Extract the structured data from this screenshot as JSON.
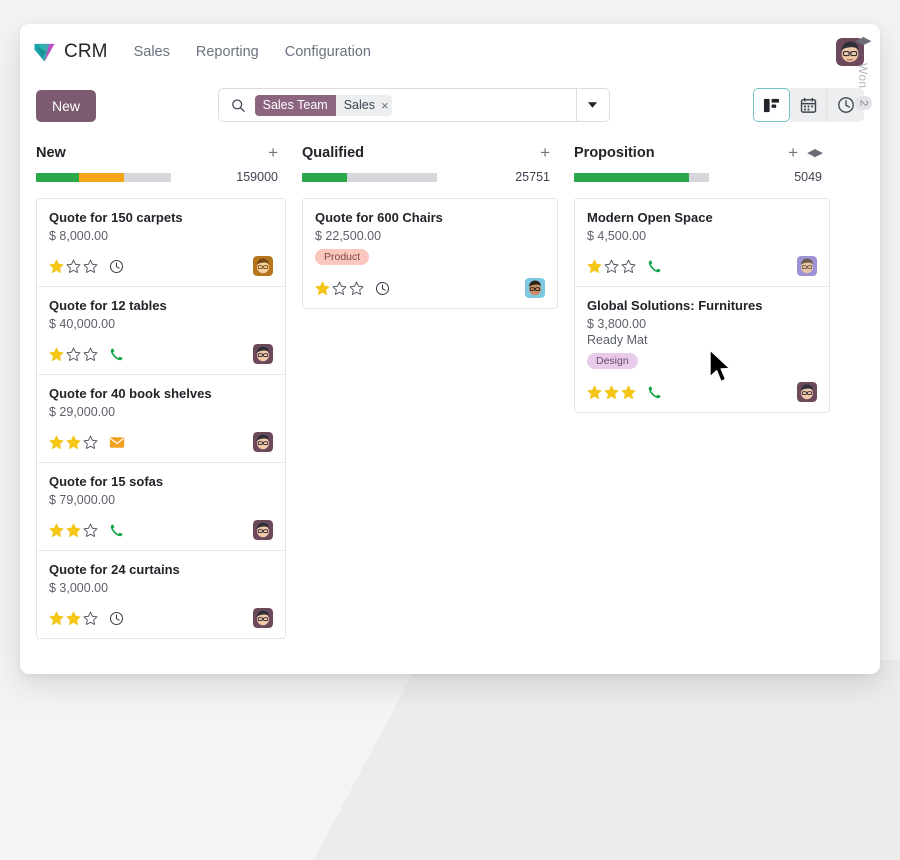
{
  "app": {
    "brand_name": "CRM",
    "logo_icon": "crm-gem-logo"
  },
  "navbar": {
    "items": [
      {
        "label": "Sales"
      },
      {
        "label": "Reporting"
      },
      {
        "label": "Configuration"
      }
    ],
    "user_avatar_icon": "user-avatar"
  },
  "controlbar": {
    "new_button_label": "New",
    "search": {
      "icon": "search-icon",
      "placeholder": "",
      "value": "",
      "facet": {
        "key": "Sales Team",
        "value": "Sales",
        "remove_label": "×"
      },
      "dropdown_icon": "chevron-down-icon"
    },
    "views": [
      {
        "name": "kanban",
        "icon": "kanban-icon",
        "active": true
      },
      {
        "name": "calendar",
        "icon": "calendar-icon",
        "active": false
      },
      {
        "name": "activity",
        "icon": "clock-icon",
        "active": false
      }
    ]
  },
  "kanban": {
    "add_icon": "plus-icon",
    "fold_icon": "fold-arrows-icon",
    "columns": [
      {
        "title": "New",
        "count": "159000",
        "progress": [
          {
            "color": "#2ba84a",
            "pct": 32
          },
          {
            "color": "#f5a518",
            "pct": 33
          },
          {
            "color": "#d6d7da",
            "pct": 35
          }
        ],
        "cards": [
          {
            "title": "Quote for 150 carpets",
            "amount": "$ 8,000.00",
            "partner": "",
            "tag": "",
            "tag_class": "",
            "stars": 1,
            "activity_icon": "clock-icon",
            "activity_color": "#3c4049",
            "avatar": "avatar-orange"
          },
          {
            "title": "Quote for 12 tables",
            "amount": "$ 40,000.00",
            "partner": "",
            "tag": "",
            "tag_class": "",
            "stars": 1,
            "activity_icon": "phone-icon",
            "activity_color": "#13a34a",
            "avatar": "avatar-plum"
          },
          {
            "title": "Quote for 40 book shelves",
            "amount": "$ 29,000.00",
            "partner": "",
            "tag": "",
            "tag_class": "",
            "stars": 2,
            "activity_icon": "envelope-icon",
            "activity_color": "#f0a122",
            "avatar": "avatar-plum"
          },
          {
            "title": "Quote for 15 sofas",
            "amount": "$ 79,000.00",
            "partner": "",
            "tag": "",
            "tag_class": "",
            "stars": 2,
            "activity_icon": "phone-icon",
            "activity_color": "#13a34a",
            "avatar": "avatar-plum"
          },
          {
            "title": "Quote for 24 curtains",
            "amount": "$ 3,000.00",
            "partner": "",
            "tag": "",
            "tag_class": "",
            "stars": 2,
            "activity_icon": "clock-icon",
            "activity_color": "#3c4049",
            "avatar": "avatar-plum"
          }
        ]
      },
      {
        "title": "Qualified",
        "count": "25751",
        "progress": [
          {
            "color": "#2ba84a",
            "pct": 33
          },
          {
            "color": "#d6d7da",
            "pct": 67
          }
        ],
        "cards": [
          {
            "title": "Quote for 600 Chairs",
            "amount": "$ 22,500.00",
            "partner": "",
            "tag": "Product",
            "tag_class": "tag-product",
            "stars": 1,
            "activity_icon": "clock-icon",
            "activity_color": "#3c4049",
            "avatar": "avatar-blue"
          }
        ]
      },
      {
        "title": "Proposition",
        "count": "5049",
        "progress": [
          {
            "color": "#2ba84a",
            "pct": 85
          },
          {
            "color": "#d6d7da",
            "pct": 15
          }
        ],
        "cards": [
          {
            "title": "Modern Open Space",
            "amount": "$ 4,500.00",
            "partner": "",
            "tag": "",
            "tag_class": "",
            "stars": 1,
            "activity_icon": "phone-icon",
            "activity_color": "#13a34a",
            "avatar": "avatar-purple"
          },
          {
            "title": "Global Solutions: Furnitures",
            "amount": "$ 3,800.00",
            "partner": "Ready Mat",
            "tag": "Design",
            "tag_class": "tag-design",
            "stars": 3,
            "activity_icon": "phone-icon",
            "activity_color": "#13a34a",
            "avatar": "avatar-plum"
          }
        ]
      }
    ],
    "folded_column": {
      "title": "Won",
      "count": "2"
    }
  },
  "colors": {
    "primary": "#7c5a70",
    "facet_key_bg": "#8c6580",
    "progress_green": "#2ba84a",
    "progress_orange": "#f5a518",
    "progress_grey": "#d6d7da",
    "star_filled": "#f5c518",
    "active_view_border": "#6fc2c6"
  }
}
